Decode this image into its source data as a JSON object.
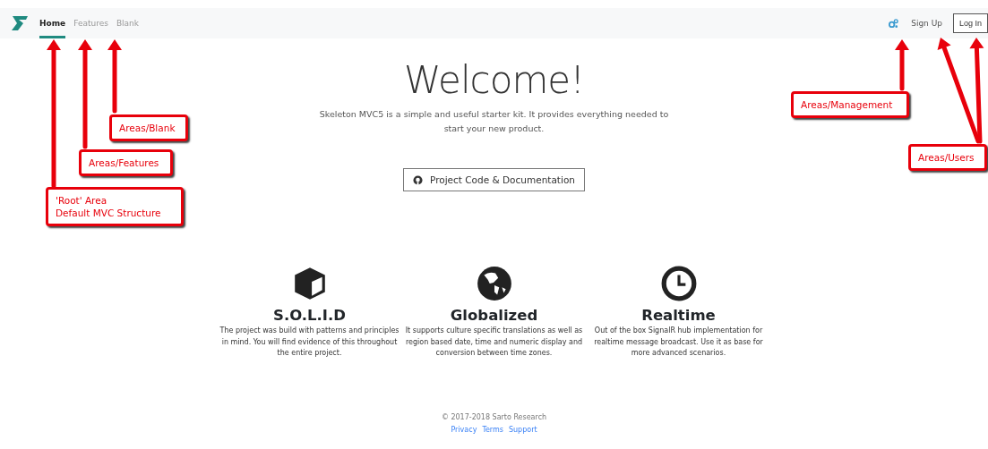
{
  "navbar": {
    "links": [
      {
        "label": "Home",
        "selected": true
      },
      {
        "label": "Features",
        "selected": false
      },
      {
        "label": "Blank",
        "selected": false
      }
    ],
    "sign_up": "Sign Up",
    "log_in": "Log In"
  },
  "hero": {
    "title": "Welcome!",
    "subtitle": "Skeleton MVC5 is a simple and useful starter kit. It provides everything needed to start your new product.",
    "button": "Project Code & Documentation"
  },
  "features": [
    {
      "kind": "cube",
      "title": "S.O.L.I.D",
      "text": "The project was build with patterns and principles in mind. You will find evidence of this throughout the entire project."
    },
    {
      "kind": "globe",
      "title": "Globalized",
      "text": "It supports culture specific translations as well as region based date, time and numeric display and conversion between time zones."
    },
    {
      "kind": "clock",
      "title": "Realtime",
      "text": "Out of the box SignalR hub implementation for realtime message broadcast. Use it as base for more advanced scenarios."
    }
  ],
  "footer": {
    "copyright": "© 2017-2018 Sarto Research",
    "links": [
      "Privacy",
      "Terms",
      "Support"
    ]
  },
  "annotations": [
    {
      "lines": [
        "Areas/Blank"
      ]
    },
    {
      "lines": [
        "Areas/Features"
      ]
    },
    {
      "lines": [
        "'Root' Area",
        "Default MVC Structure"
      ]
    },
    {
      "lines": [
        "Areas/Management"
      ]
    },
    {
      "lines": [
        "Areas/Users"
      ]
    }
  ]
}
